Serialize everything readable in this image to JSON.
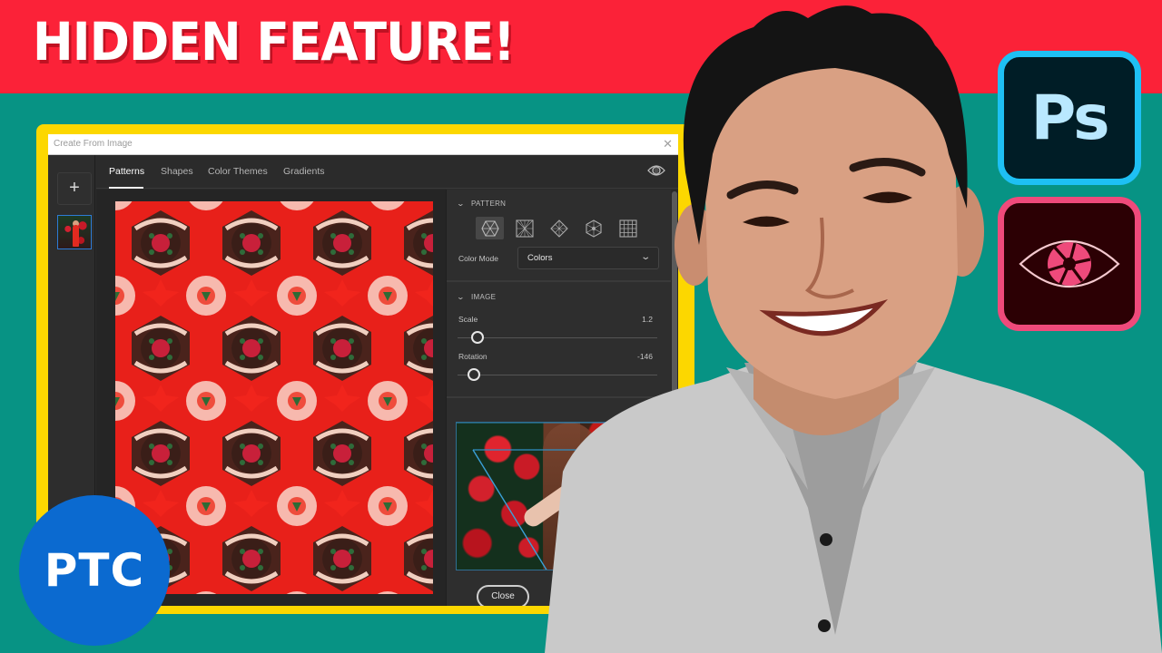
{
  "thumbnail": {
    "headline": "HIDDEN FEATURE!",
    "colors": {
      "banner_red": "#fb2238",
      "background_teal": "#079384",
      "frame_yellow": "#fcd700",
      "ptc_blue": "#0b6ad0",
      "ps_border": "#1ec0f4",
      "capture_border": "#ef4a7b"
    }
  },
  "dialog": {
    "title": "Create From Image",
    "close_icon": "close-x-icon",
    "left_rail": {
      "add_label": "+",
      "thumbnail_alt": "woman-in-red-dress-among-roses"
    },
    "tabs": [
      {
        "label": "Patterns",
        "active": true
      },
      {
        "label": "Shapes",
        "active": false
      },
      {
        "label": "Color Themes",
        "active": false
      },
      {
        "label": "Gradients",
        "active": false
      }
    ],
    "preview_toggle_icon": "eye-icon",
    "pattern_section": {
      "title": "PATTERN",
      "types": [
        {
          "name": "hexagon-kaleidoscope",
          "active": true
        },
        {
          "name": "square-radial",
          "active": false
        },
        {
          "name": "diamond",
          "active": false
        },
        {
          "name": "hexagon-radial",
          "active": false
        },
        {
          "name": "grid",
          "active": false
        }
      ],
      "color_mode_label": "Color Mode",
      "color_mode_value": "Colors"
    },
    "image_section": {
      "title": "IMAGE",
      "scale_label": "Scale",
      "scale_value": "1.2",
      "scale_fraction": 0.1,
      "rotation_label": "Rotation",
      "rotation_value": "-146",
      "rotation_fraction": 0.08
    },
    "close_button": "Close"
  },
  "logos": {
    "photoshop": "Ps",
    "capture": "capture-eye-shutter-icon",
    "ptc": "PTC"
  }
}
